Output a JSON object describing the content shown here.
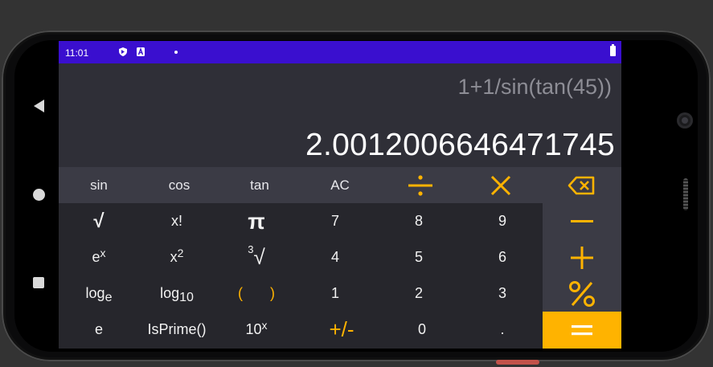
{
  "status_bar": {
    "time": "11:01",
    "icons": [
      "shield-icon",
      "a-badge-icon",
      "dot-icon",
      "battery-icon"
    ]
  },
  "display": {
    "expression": "1+1/sin(tan(45))",
    "result": "2.0012006646471745"
  },
  "top_row": [
    {
      "label": "sin"
    },
    {
      "label": "cos"
    },
    {
      "label": "tan"
    },
    {
      "label": "AC"
    },
    {
      "icon": "divide-icon"
    },
    {
      "icon": "multiply-icon"
    },
    {
      "icon": "backspace-icon"
    }
  ],
  "sci_keys": {
    "sqrt": "√",
    "factorial": "x!",
    "pi": "π",
    "exp_base": "e",
    "exp_sup": "x",
    "square_base": "x",
    "square_sup": "2",
    "cbrt_index": "3",
    "cbrt_symbol": "√",
    "ln_base": "log",
    "ln_sub": "e",
    "log10_base": "log",
    "log10_sub": "10",
    "paren_open": "(",
    "paren_close": ")",
    "euler": "e",
    "isprime": "IsPrime()",
    "pow10_base": "10",
    "pow10_sup": "x"
  },
  "digits": {
    "d7": "7",
    "d8": "8",
    "d9": "9",
    "d4": "4",
    "d5": "5",
    "d6": "6",
    "d1": "1",
    "d2": "2",
    "d3": "3",
    "sign": "+/-",
    "d0": "0",
    "dot": "."
  },
  "operators": [
    "minus-icon",
    "plus-icon",
    "percent-icon",
    "equals-icon"
  ],
  "colors": {
    "accent": "#ffb300",
    "status_bar": "#3a0fcf",
    "display_bg": "#2f2f37",
    "keypad_bg": "#26262c",
    "panel_bg": "#3b3b45"
  }
}
